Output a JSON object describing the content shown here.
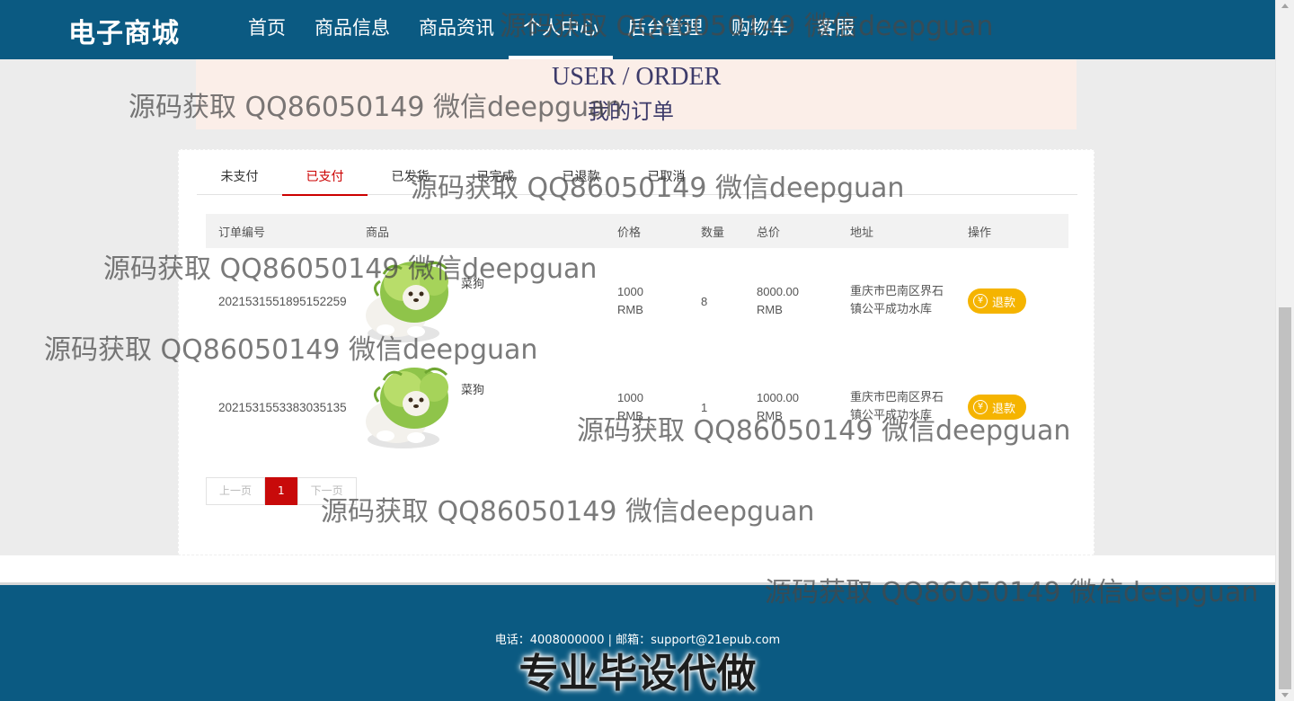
{
  "brand": "电子商城",
  "nav": [
    {
      "label": "首页",
      "active": false
    },
    {
      "label": "商品信息",
      "active": false
    },
    {
      "label": "商品资讯",
      "active": false
    },
    {
      "label": "个人中心",
      "active": true
    },
    {
      "label": "后台管理",
      "active": false
    },
    {
      "label": "购物车",
      "active": false
    },
    {
      "label": "客服",
      "active": false
    }
  ],
  "banner": {
    "en": "USER / ORDER",
    "zh": "我的订单"
  },
  "tabs": [
    {
      "label": "未支付",
      "active": false
    },
    {
      "label": "已支付",
      "active": true
    },
    {
      "label": "已发货",
      "active": false
    },
    {
      "label": "已完成",
      "active": false
    },
    {
      "label": "已退款",
      "active": false
    },
    {
      "label": "已取消",
      "active": false
    }
  ],
  "table": {
    "headers": {
      "id": "订单编号",
      "product": "商品",
      "price": "价格",
      "qty": "数量",
      "total": "总价",
      "address": "地址",
      "op": "操作"
    },
    "rows": [
      {
        "id": "2021531551895152259",
        "product": "菜狗",
        "price": "1000",
        "price_unit": "RMB",
        "qty": "8",
        "total": "8000.00",
        "total_unit": "RMB",
        "address": "重庆市巴南区界石镇公平成功水库",
        "action": "退款",
        "action_icon": "yen-icon"
      },
      {
        "id": "2021531553383035135",
        "product": "菜狗",
        "price": "1000",
        "price_unit": "RMB",
        "qty": "1",
        "total": "1000.00",
        "total_unit": "RMB",
        "address": "重庆市巴南区界石镇公平成功水库",
        "action": "退款",
        "action_icon": "yen-icon"
      }
    ]
  },
  "pager": {
    "prev": "上一页",
    "current": "1",
    "next": "下一页"
  },
  "footer": {
    "contact": "电话：4008000000 | 邮箱：support@21epub.com",
    "slogan": "专业毕设代做"
  },
  "watermark": "源码获取 QQ86050149 微信deepguan",
  "colors": {
    "primary": "#0b5a82",
    "accent": "#c80a0a",
    "refund": "#f5b400",
    "banner_bg": "#fbeee8"
  }
}
